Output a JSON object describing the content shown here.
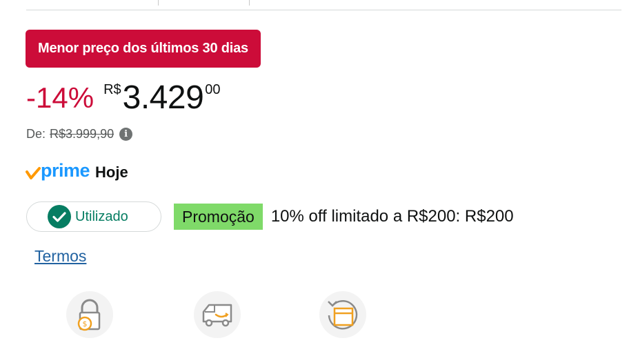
{
  "deal_badge": "Menor preço dos últimos 30 dias",
  "price": {
    "discount": "-14%",
    "currency": "R$",
    "whole": "3.429",
    "fraction": "00"
  },
  "list_price": {
    "label": "De:",
    "value": "R$3.999,90",
    "info_icon": "info-icon"
  },
  "prime": {
    "logo_text": "prime",
    "delivery": "Hoje"
  },
  "coupon": {
    "status": "Utilizado",
    "promo_label": "Promoção",
    "promo_text": "10% off limitado a R$200: R$200"
  },
  "terms_link": "Termos",
  "feature_icons": [
    "secure-payment-icon",
    "delivery-van-icon",
    "returns-box-icon"
  ],
  "colors": {
    "deal_red": "#cc0c39",
    "prime_blue": "#1a98ff",
    "prime_orange": "#ff9900",
    "success_green": "#067d62",
    "promo_green": "#7fda69",
    "link_blue": "#2162a1"
  }
}
